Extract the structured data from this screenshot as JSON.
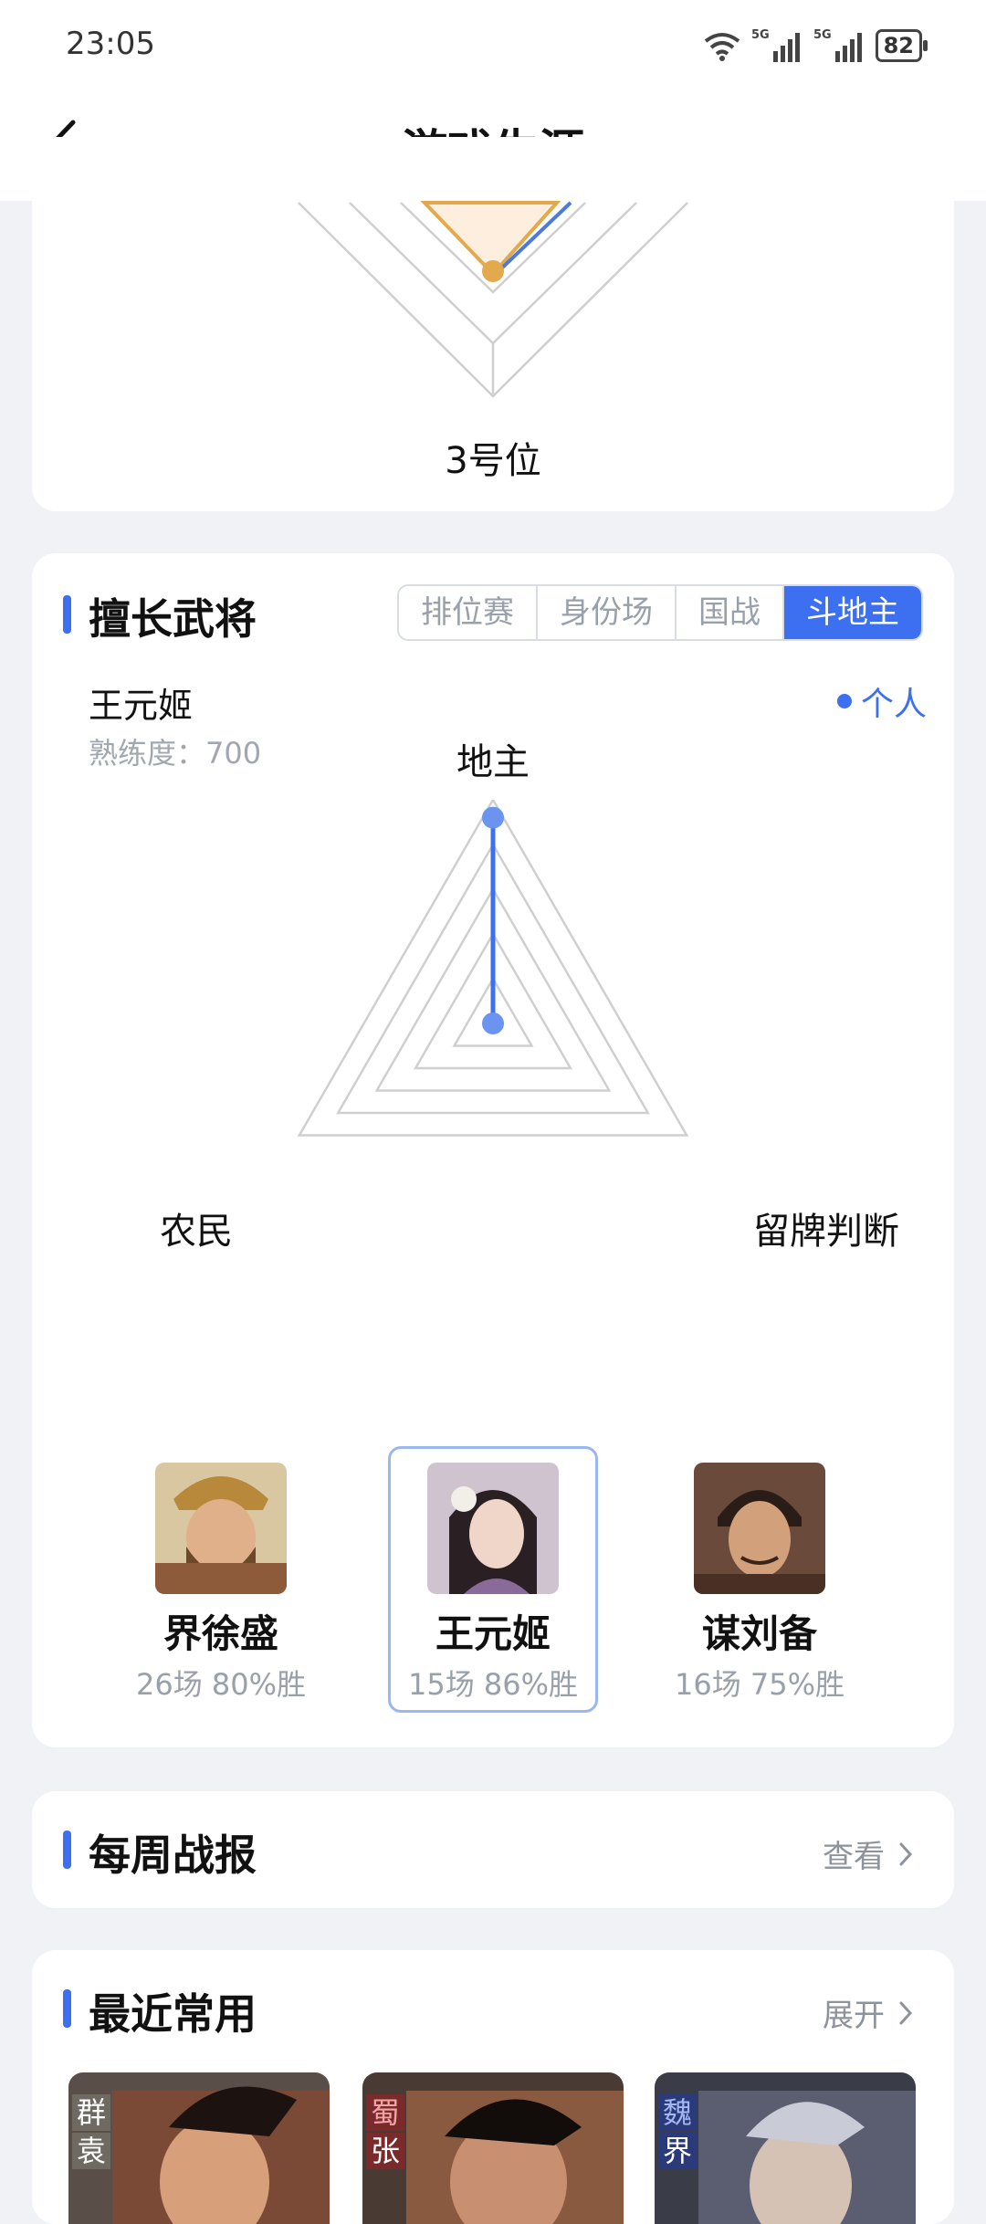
{
  "status": {
    "time": "23:05",
    "battery": "82",
    "net1": "5G",
    "net2": "5G"
  },
  "nav": {
    "title": "游戏生涯"
  },
  "top_radar": {
    "bottom_label": "3号位"
  },
  "generals": {
    "section_title": "擅长武将",
    "tabs": [
      {
        "label": "排位赛",
        "active": false
      },
      {
        "label": "身份场",
        "active": false
      },
      {
        "label": "国战",
        "active": false
      },
      {
        "label": "斗地主",
        "active": true
      }
    ],
    "selected_name": "王元姬",
    "proficiency": "熟练度：700",
    "legend": "个人",
    "radar_axes": {
      "top": "地主",
      "left": "农民",
      "right": "留牌判断"
    },
    "radar_values": {
      "top": 0.92,
      "left": 0.0,
      "right": 0.0
    },
    "heroes": [
      {
        "name": "界徐盛",
        "stats": "26场 80%胜",
        "selected": false
      },
      {
        "name": "王元姬",
        "stats": "15场 86%胜",
        "selected": true
      },
      {
        "name": "谋刘备",
        "stats": "16场 75%胜",
        "selected": false
      }
    ]
  },
  "weekly": {
    "title": "每周战报",
    "link": "查看"
  },
  "recent": {
    "title": "最近常用",
    "link": "展开",
    "cards": [
      {
        "faction": "群",
        "name": "袁"
      },
      {
        "faction": "蜀",
        "name": "张"
      },
      {
        "faction": "魏",
        "name": "界"
      }
    ]
  },
  "colors": {
    "accent": "#3d6ff1",
    "orange": "#e4a94c",
    "background": "#f1f2f6"
  }
}
